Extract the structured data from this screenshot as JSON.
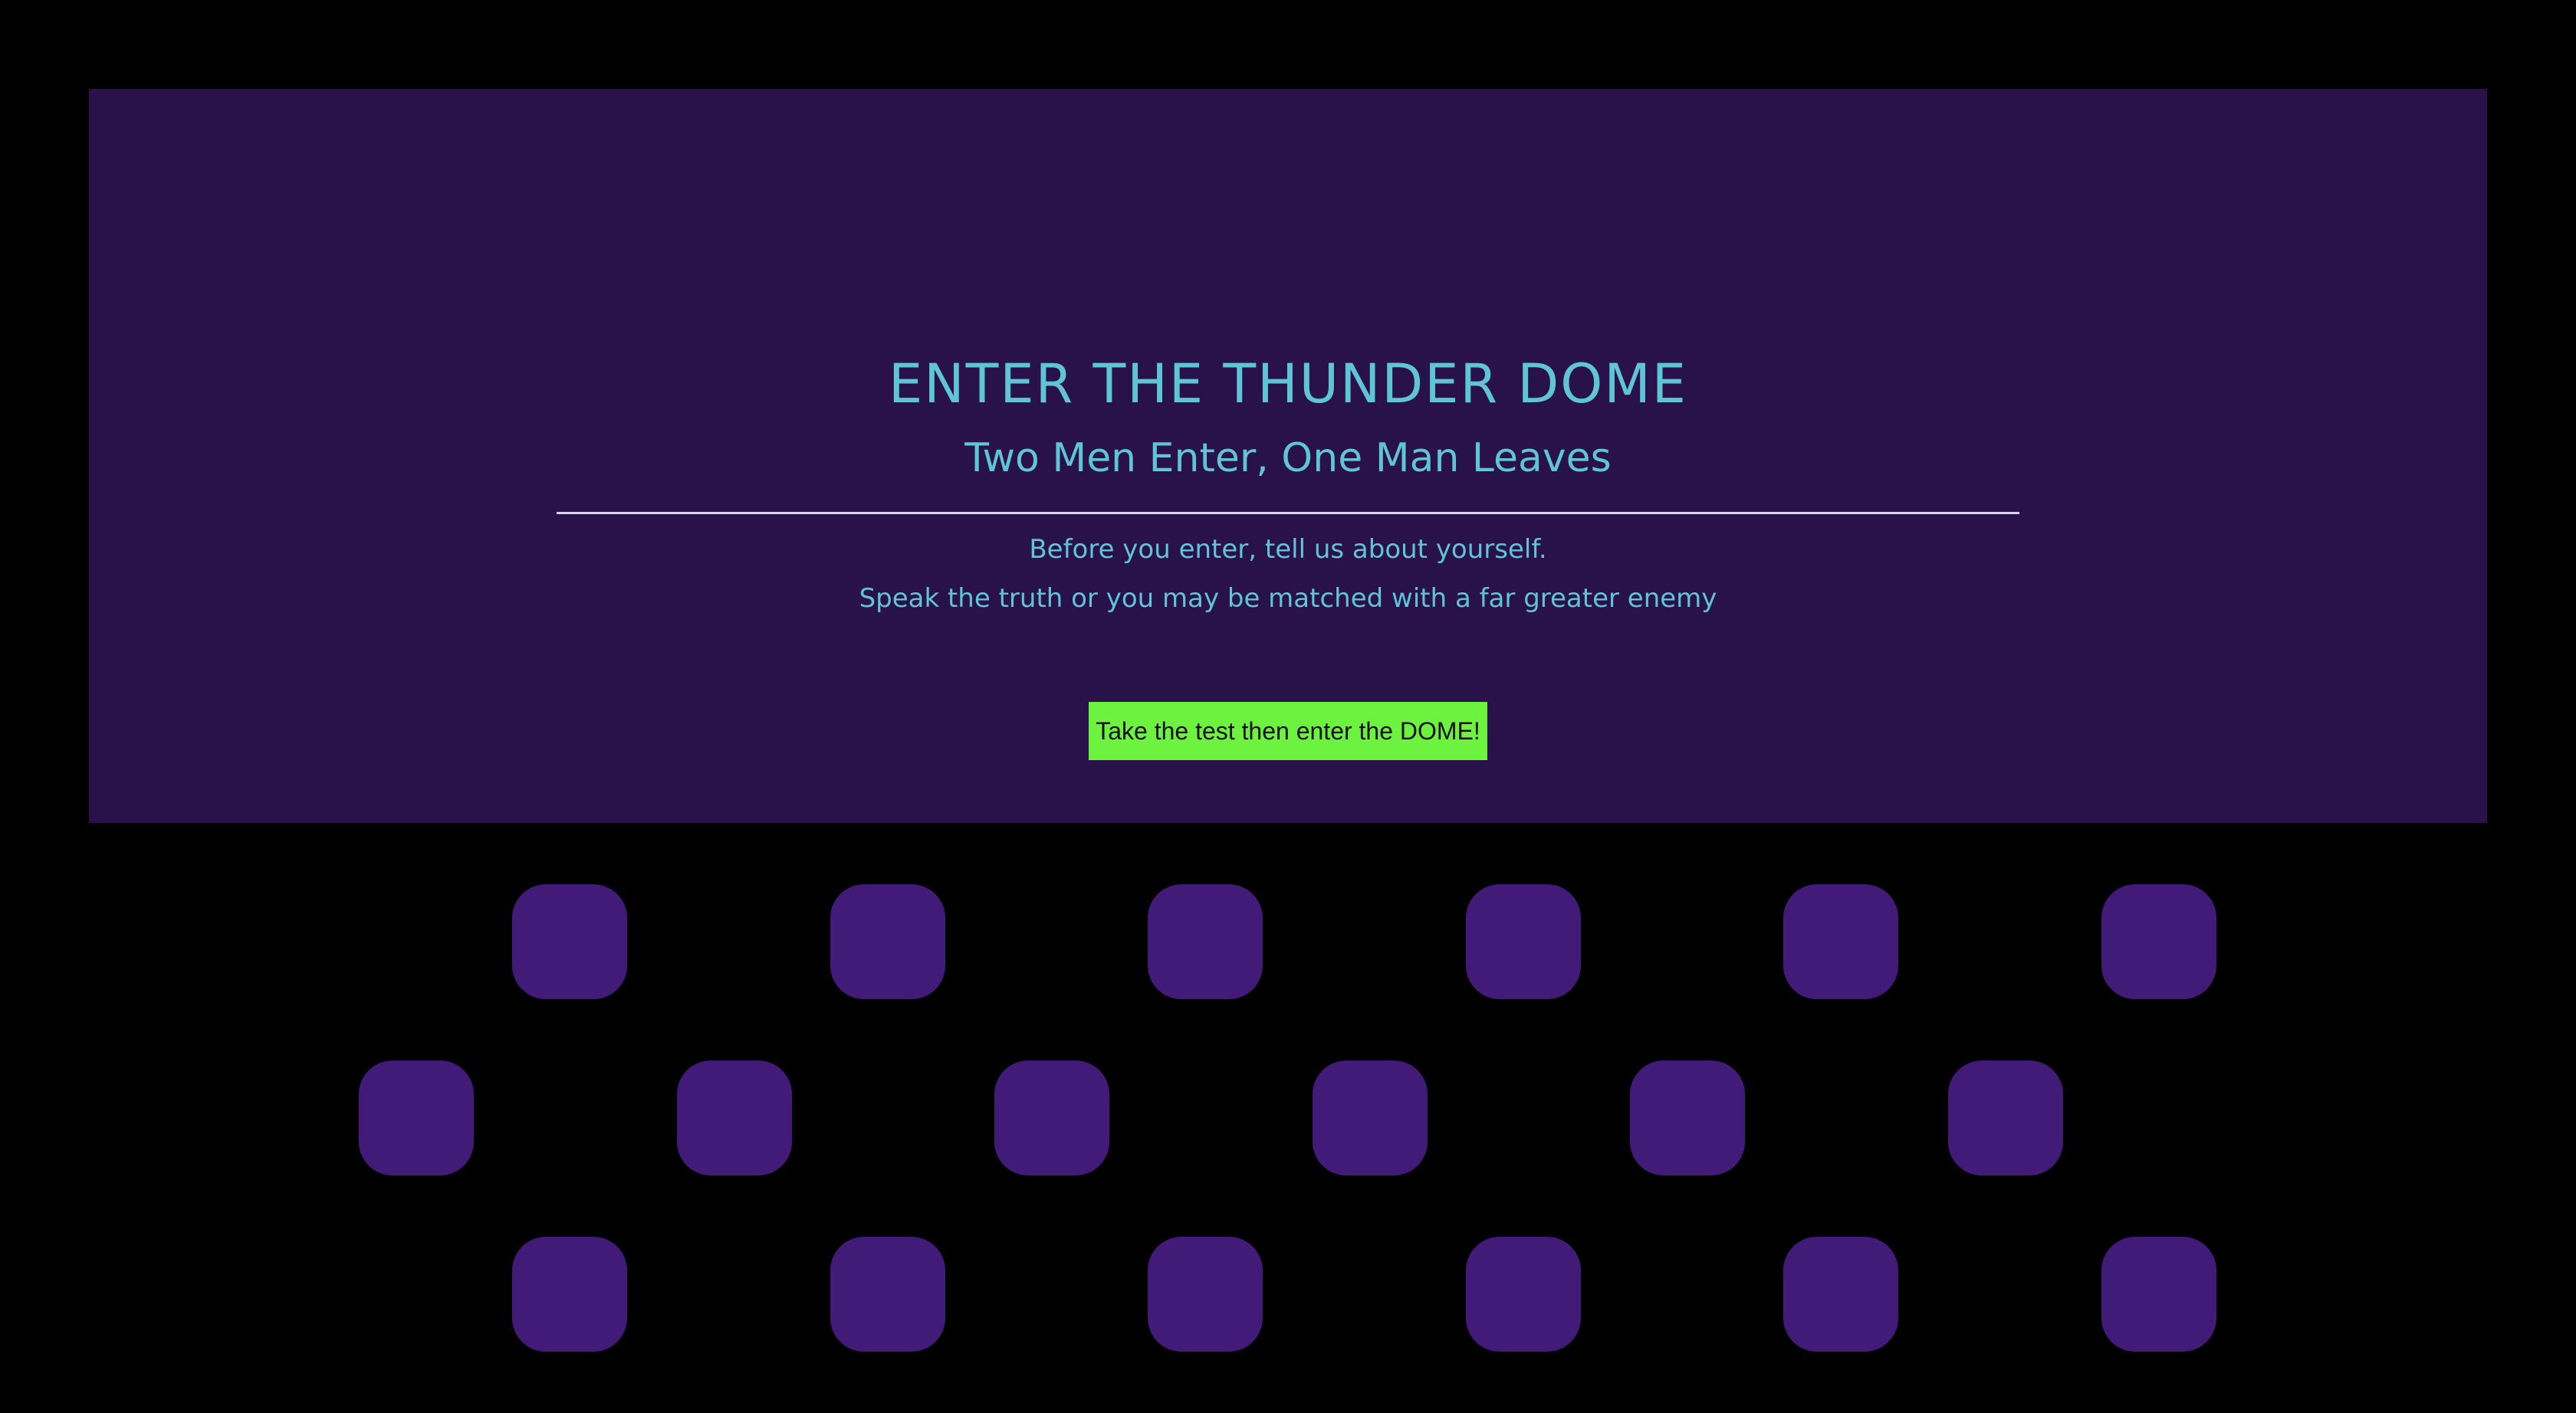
{
  "hero": {
    "title": "ENTER THE THUNDER DOME",
    "subtitle": "Two Men Enter, One Man Leaves",
    "intro_line_1": "Before you enter, tell us about yourself.",
    "intro_line_2": "Speak the truth or you may be matched with a far greater enemy",
    "cta_label": "Take the test then enter the DOME!"
  },
  "colors": {
    "page_background": "#000000",
    "hero_background": "#29114a",
    "heading_text": "#5ec4d6",
    "button_background": "#6ef240",
    "tile_fill": "#421a78"
  },
  "tiles": {
    "row_counts": [
      6,
      6,
      6
    ]
  }
}
